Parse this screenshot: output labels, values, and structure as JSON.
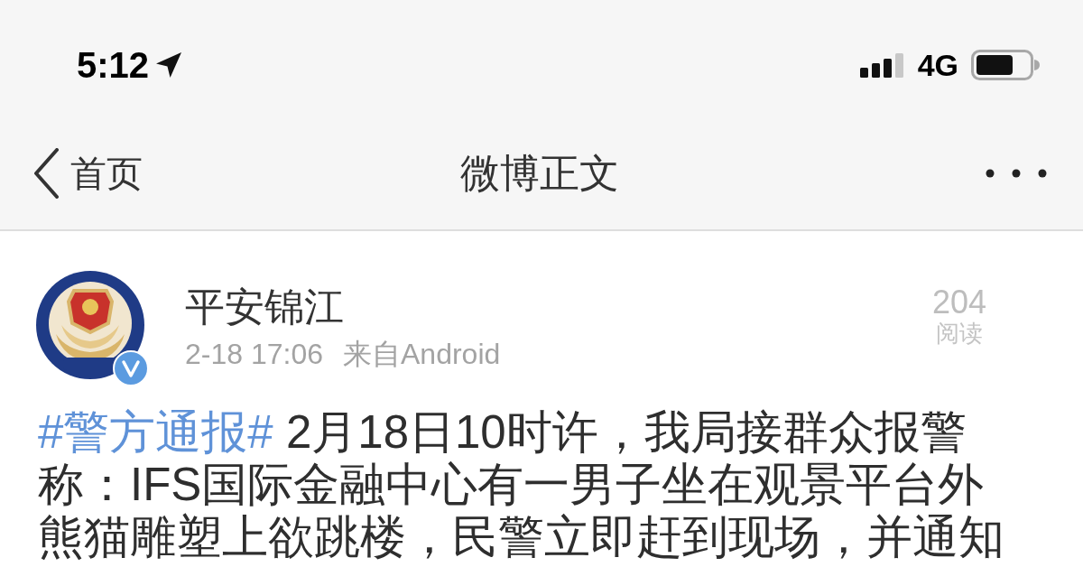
{
  "status_bar": {
    "time": "5:12",
    "network": "4G"
  },
  "nav_bar": {
    "back": "首页",
    "title": "微博正文"
  },
  "post": {
    "author": "平安锦江",
    "verified": true,
    "time": "2-18 17:06",
    "source": "来自Android",
    "read_count": "204",
    "read_label": "阅读",
    "body": {
      "hashtag": "#警方通报#",
      "lines": [
        "2月18日10时许，我局接群众报警",
        "称：IFS国际金融中心有一男子坐在观景平台外",
        "熊猫雕塑上欲跳楼，民警立即赶到现场，并通知"
      ]
    }
  }
}
